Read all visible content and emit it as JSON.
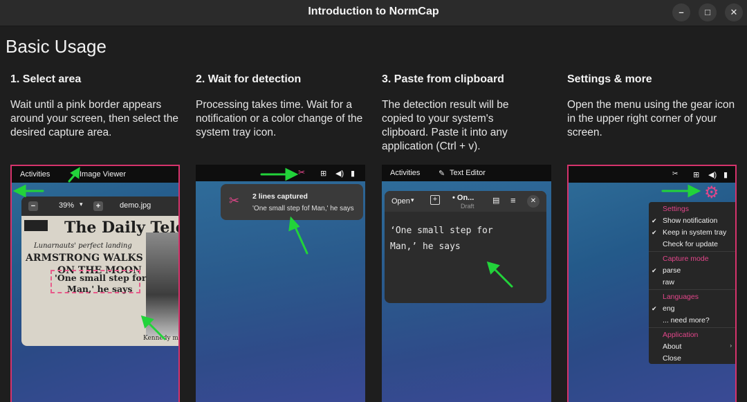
{
  "window": {
    "title": "Introduction to NormCap",
    "minimize": "–",
    "maximize": "□",
    "close": "✕"
  },
  "page_title": "Basic Usage",
  "columns": [
    {
      "heading": "1. Select area",
      "body": "Wait until a pink border appears around your screen, then select the desired capture area."
    },
    {
      "heading": "2. Wait for detection",
      "body": "Processing takes time. Wait for a notification or a color change of the system tray icon."
    },
    {
      "heading": "3. Paste from clipboard",
      "body": "The detection result will be copied to your system's clipboard. Paste it into any application (Ctrl + v)."
    },
    {
      "heading": "Settings & more",
      "body": "Open the menu using the gear icon in the upper right corner of your screen."
    }
  ],
  "shot1": {
    "activities": "Activities",
    "app": "Image Viewer",
    "zoom": "39%",
    "file": "demo.jpg",
    "news_mast": "The Daily Teleg",
    "news_l1": "Lunarnauts' perfect landing",
    "news_l2": "ARMSTRONG WALKS",
    "news_l3": "ON THE MOON",
    "news_q1": "'One small step for",
    "news_q2": "Man,' he says",
    "news_caption": "Kennedy m"
  },
  "shot2": {
    "notif_title": "2 lines captured",
    "notif_body": "'One small step fof Man,' he says"
  },
  "shot3": {
    "activities": "Activities",
    "app": "Text Editor",
    "open": "Open",
    "doc_title": "• On...",
    "doc_sub": "Draft",
    "line1": "‘One small step for",
    "line2": "Man,’ he says"
  },
  "menu": {
    "settings": "Settings",
    "show_notification": "Show notification",
    "keep_tray": "Keep in system tray",
    "check_update": "Check for update",
    "capture_mode": "Capture mode",
    "parse": "parse",
    "raw": "raw",
    "languages": "Languages",
    "eng": "eng",
    "need_more": "... need more?",
    "application": "Application",
    "about": "About",
    "close": "Close"
  },
  "colors": {
    "accent_pink": "#d6336c",
    "menu_section": "#e2468a",
    "arrow_green": "#22d33a"
  }
}
